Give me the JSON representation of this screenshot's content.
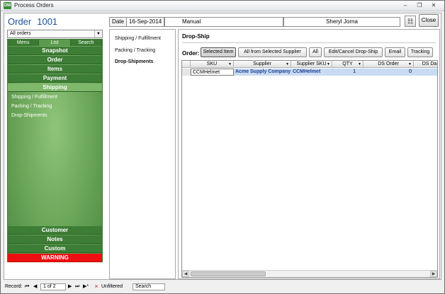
{
  "window": {
    "title": "Process Orders",
    "icon_text": "DM"
  },
  "order": {
    "label": "Order",
    "number": "1001"
  },
  "filter": {
    "value": "All orders"
  },
  "nav": {
    "tabs": [
      "Menu",
      "List",
      "Search"
    ],
    "items": [
      "Snapshot",
      "Order",
      "Items",
      "Payment",
      "Shipping"
    ],
    "subitems": [
      "Shipping / Fulfillment",
      "Packing / Tracking",
      "Drop-Shipments"
    ],
    "bottom_items": [
      "Customer",
      "Notes",
      "Custom"
    ],
    "warning": "WARNING"
  },
  "header": {
    "date_label": "Date",
    "date": "16-Sep-2014",
    "source": "Manual",
    "customer": "Sheryl Jorna",
    "close_label": "Close"
  },
  "submenu": [
    "Shipping / Fulfillment",
    "Packing / Tracking",
    "Drop-Shipments"
  ],
  "dropship": {
    "title": "Drop-Ship",
    "order_label": "Order:",
    "buttons": [
      "Selected Item",
      "All from Selected Supplier",
      "All",
      "Edit/Cancel Drop-Ship",
      "Email",
      "Tracking"
    ],
    "columns": [
      "SKU",
      "Supplier",
      "Supplier SKU",
      "QTY",
      "DS Order",
      "DS Da"
    ],
    "rows": [
      {
        "sku": "CCMHelmet",
        "supplier": "Acme Supply Company",
        "supplier_sku": "CCMHelmet",
        "qty": "1",
        "ds_order": "0",
        "ds_date": ""
      }
    ]
  },
  "status": {
    "record_label": "Record:",
    "record_pos": "1 of 2",
    "filter_state": "Unfiltered",
    "search_label": "Search"
  },
  "colors": {
    "nav_green": "#3e7d36",
    "nav_active": "#7fb86b",
    "warning": "#ee1010",
    "title_blue": "#1f4f8e",
    "row_select": "#c7dcf4"
  }
}
